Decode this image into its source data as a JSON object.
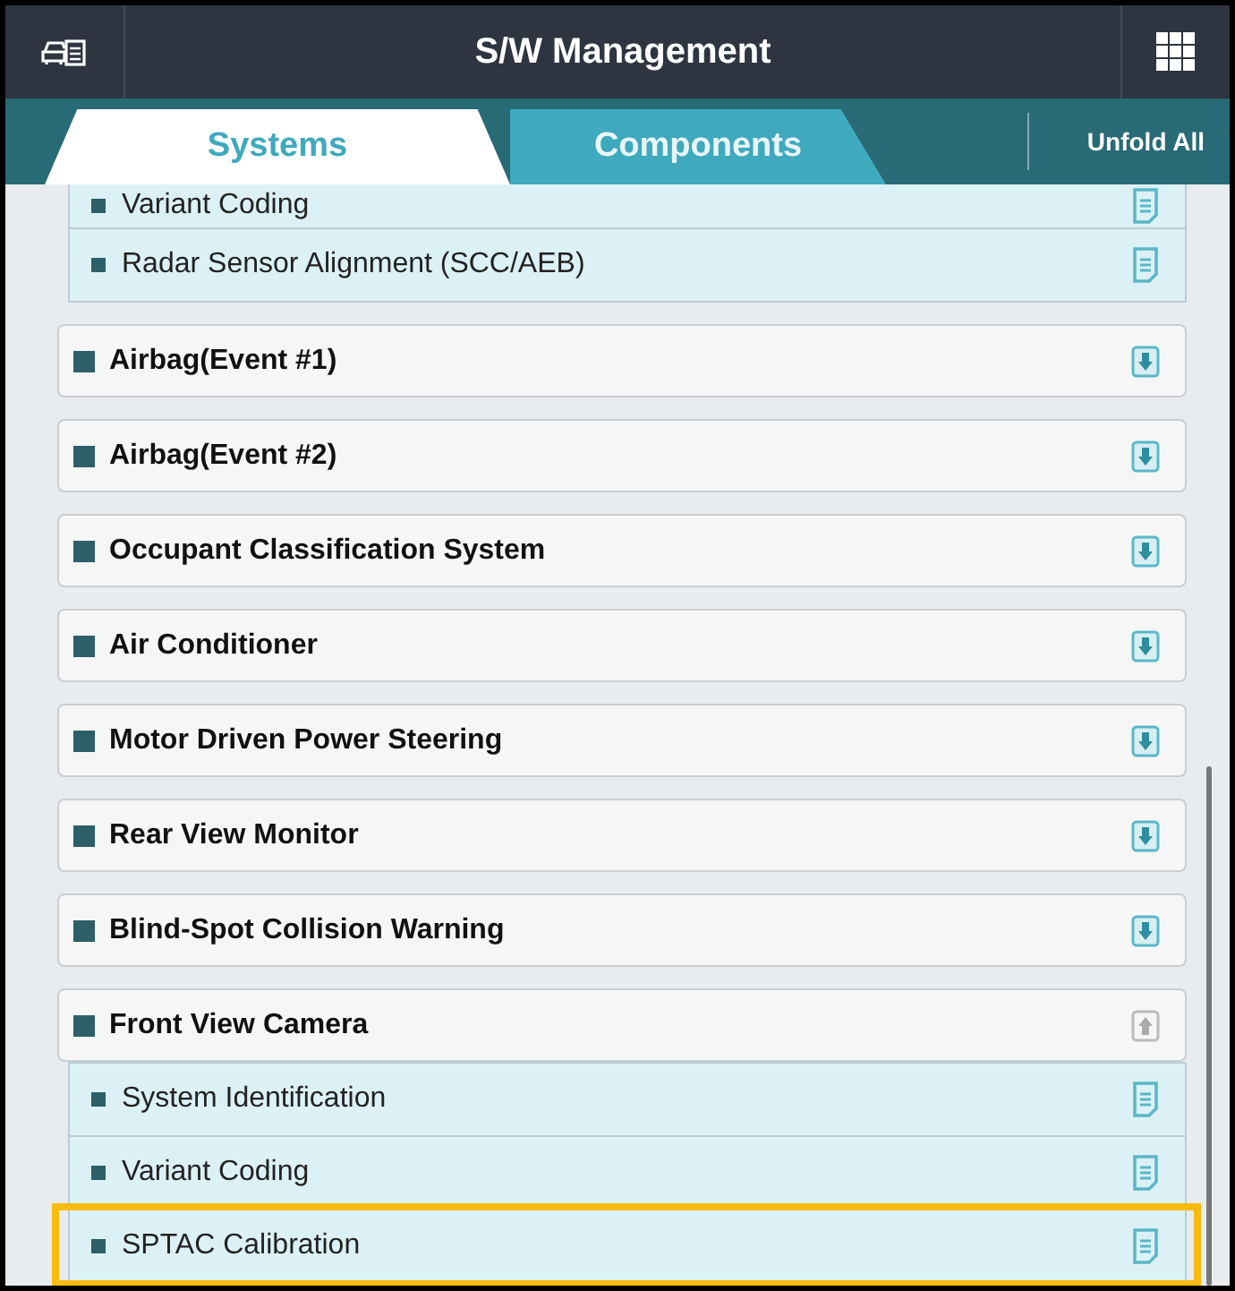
{
  "header": {
    "title": "S/W Management"
  },
  "tabs": [
    {
      "label": "Systems",
      "selected": true
    },
    {
      "label": "Components",
      "selected": false
    }
  ],
  "unfold_button": "Unfold All",
  "top_children": [
    {
      "label": "Variant Coding",
      "highlighted": false
    },
    {
      "label": "Radar Sensor Alignment (SCC/AEB)",
      "highlighted": false
    }
  ],
  "systems": [
    {
      "label": "Airbag(Event #1)",
      "expanded": false
    },
    {
      "label": "Airbag(Event #2)",
      "expanded": false
    },
    {
      "label": "Occupant Classification System",
      "expanded": false
    },
    {
      "label": "Air Conditioner",
      "expanded": false
    },
    {
      "label": "Motor Driven Power Steering",
      "expanded": false
    },
    {
      "label": "Rear View Monitor",
      "expanded": false
    },
    {
      "label": "Blind-Spot Collision Warning",
      "expanded": false
    },
    {
      "label": "Front View Camera",
      "expanded": true,
      "children": [
        {
          "label": "System Identification",
          "highlighted": false
        },
        {
          "label": "Variant Coding",
          "highlighted": false
        },
        {
          "label": "SPTAC Calibration",
          "highlighted": true
        }
      ]
    }
  ]
}
